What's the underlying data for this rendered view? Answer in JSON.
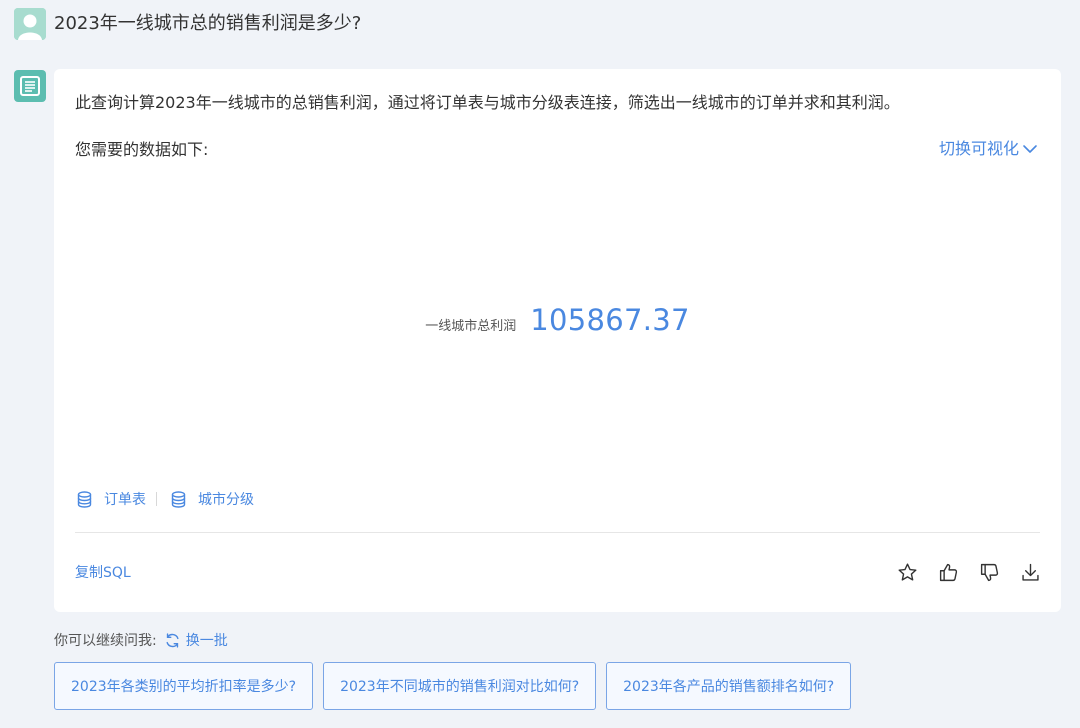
{
  "header": {
    "question": "2023年一线城市总的销售利润是多少?"
  },
  "answer": {
    "description": "此查询计算2023年一线城市的总销售利润，通过将订单表与城市分级表连接，筛选出一线城市的订单并求和其利润。",
    "data_intro": "您需要的数据如下:",
    "toggle_label": "切换可视化",
    "metric": {
      "label": "一线城市总利润",
      "value": "105867.37"
    },
    "sources": [
      {
        "label": "订单表",
        "icon": "database-icon"
      },
      {
        "label": "城市分级",
        "icon": "database-icon"
      }
    ],
    "copy_sql_label": "复制SQL",
    "actions": [
      "star-icon",
      "thumbs-up-icon",
      "thumbs-down-icon",
      "download-icon"
    ]
  },
  "suggestions": {
    "title": "你可以继续问我:",
    "refresh_label": "换一批",
    "items": [
      "2023年各类别的平均折扣率是多少?",
      "2023年不同城市的销售利润对比如何?",
      "2023年各产品的销售额排名如何?"
    ]
  },
  "colors": {
    "accent": "#4a88e0",
    "page_bg": "#f0f3f8",
    "bot_avatar": "#5cbdb0",
    "user_avatar": "#9fd6c9"
  }
}
